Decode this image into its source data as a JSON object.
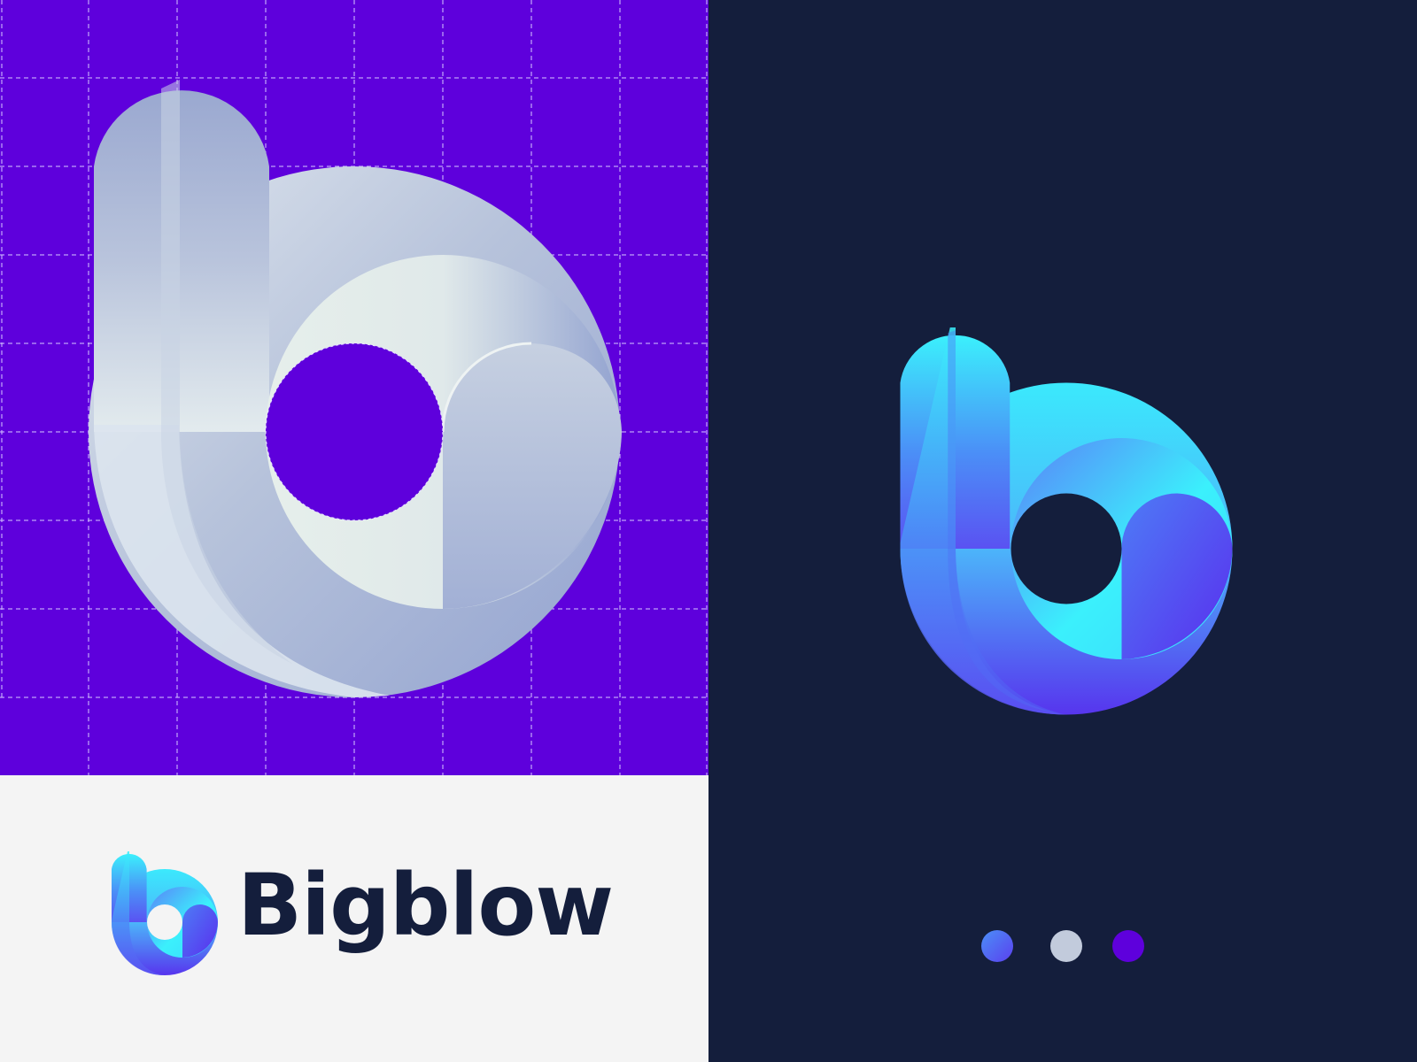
{
  "brand": {
    "name": "Bigblow"
  },
  "logo": {
    "icon": "bigblow-b-logo-icon",
    "gradient_light": [
      "#dde4ee",
      "#93a3d0",
      "#c5cfe0"
    ],
    "gradient_blue": [
      "#3bf0fc",
      "#4b8ff7",
      "#5735ee"
    ]
  },
  "colors": {
    "grid_background": "#5e00dc",
    "dark_background": "#141e3c",
    "light_background": "#f4f4f4",
    "grid_lines": "#d6c7ff",
    "text": "#141e3c"
  },
  "palette": [
    {
      "name": "blue-gradient",
      "color": "#5b6cf6"
    },
    {
      "name": "silver",
      "color": "#c2cbdc"
    },
    {
      "name": "violet",
      "color": "#5e00dc"
    }
  ]
}
